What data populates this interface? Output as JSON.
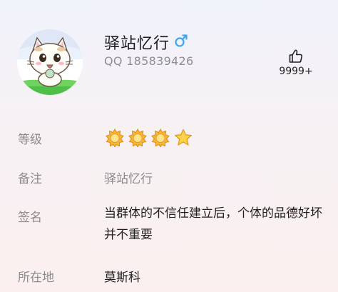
{
  "profile": {
    "nickname": "驿站忆行",
    "gender_symbol": "♂",
    "gender_color": "#3aa5f0",
    "qq_label": "QQ 185839426",
    "like_count": "9999+"
  },
  "details": {
    "level_label": "等级",
    "level_badges": [
      "sun",
      "sun",
      "sun",
      "star"
    ],
    "remark_label": "备注",
    "remark_value": "驿站忆行",
    "signature_label": "签名",
    "signature_value": "当群体的不信任建立后，个体的品德好坏并不重要",
    "location_label": "所在地",
    "location_value": "莫斯科"
  },
  "icons": {
    "like": "thumbs-up-icon",
    "gender": "male-icon",
    "sun_badge": "sun-level-icon",
    "star_badge": "star-level-icon"
  }
}
